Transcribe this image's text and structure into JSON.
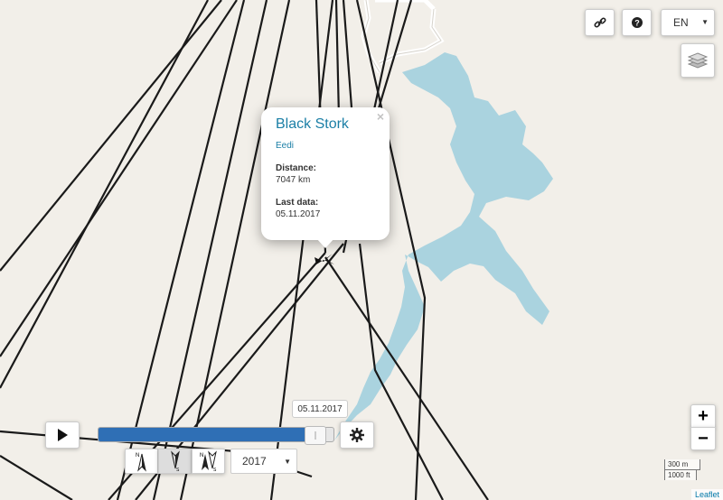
{
  "popup": {
    "title": "Black Stork",
    "bird_name": "Eedi",
    "distance_label": "Distance:",
    "distance_value": "7047 km",
    "last_data_label": "Last data:",
    "last_data_value": "05.11.2017",
    "close_symbol": "×"
  },
  "controls": {
    "language": "EN",
    "zoom_in": "+",
    "zoom_out": "−",
    "link_icon": "link-icon",
    "help_icon": "question-icon",
    "layers_icon": "layers-icon"
  },
  "timeline": {
    "current_date": "05.11.2017",
    "progress_percent": 92,
    "year": "2017",
    "settings_icon": "gear-icon",
    "play_icon": "play-icon"
  },
  "compass_buttons": [
    {
      "icon": "compass-north-icon",
      "label_top": "N",
      "label_bottom": ""
    },
    {
      "icon": "compass-south-icon",
      "label_top": "",
      "label_bottom": "S"
    },
    {
      "icon": "compass-both-icon",
      "label_top": "N",
      "label_bottom": "S"
    }
  ],
  "scale": {
    "metric": "300 m",
    "imperial": "1000 ft"
  },
  "attribution": "Leaflet",
  "colors": {
    "water": "#aad3df",
    "land": "#f2efe9",
    "track": "#1a1a1a",
    "timeline_fill": "#2f6fb5",
    "popup_title": "#1b7fa6"
  }
}
